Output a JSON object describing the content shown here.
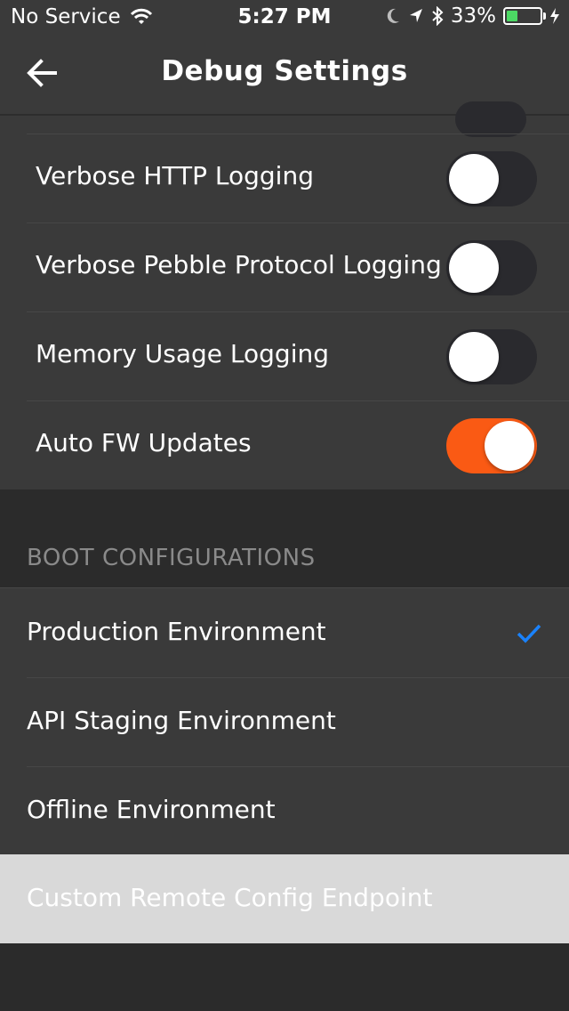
{
  "status": {
    "carrier": "No Service",
    "time": "5:27 PM",
    "battery_text": "33%",
    "battery_level": 0.33,
    "battery_color": "#4cd964"
  },
  "nav": {
    "title": "Debug Settings",
    "back_icon": "arrow-left-icon"
  },
  "toggles": [
    {
      "label": "Verbose HTTP Logging",
      "on": false
    },
    {
      "label": "Verbose Pebble Protocol Logging",
      "on": false
    },
    {
      "label": "Memory Usage Logging",
      "on": false
    },
    {
      "label": "Auto FW Updates",
      "on": true
    }
  ],
  "boot": {
    "header": "BOOT CONFIGURATIONS",
    "options": [
      {
        "label": "Production Environment",
        "selected": true
      },
      {
        "label": "API Staging Environment",
        "selected": false
      },
      {
        "label": "Offline Environment",
        "selected": false
      }
    ],
    "custom": "Custom Remote Config Endpoint"
  },
  "colors": {
    "accent_on": "#fa5a14",
    "checkmark": "#1a82fb"
  }
}
